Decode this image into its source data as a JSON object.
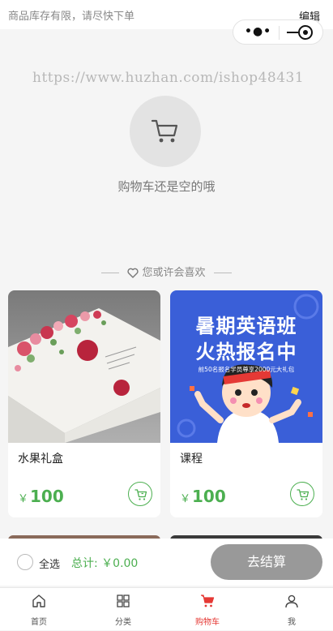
{
  "header": {
    "notice": "商品库存有限，请尽快下单",
    "edit_label": "编辑"
  },
  "watermark": "https://www.huzhan.com/ishop48431",
  "empty": {
    "icon": "cart-icon",
    "message": "购物车还是空的哦"
  },
  "recommend": {
    "title": "您或许会喜欢",
    "icon": "heart-icon",
    "items": [
      {
        "name": "水果礼盒",
        "currency": "￥",
        "price": "100",
        "image": "gift-box-photo"
      },
      {
        "name": "课程",
        "currency": "￥",
        "price": "100",
        "image": "course-poster",
        "poster_line1": "暑期英语班",
        "poster_line2": "火热报名中",
        "poster_sub": "前50名报名学员尊享2000元大礼包"
      }
    ]
  },
  "checkout": {
    "select_all": "全选",
    "total": "总计: ￥0.00",
    "button": "去结算"
  },
  "tabbar": [
    {
      "label": "首页",
      "icon": "home-icon"
    },
    {
      "label": "分类",
      "icon": "category-icon"
    },
    {
      "label": "购物车",
      "icon": "cart-icon",
      "active": true
    },
    {
      "label": "我",
      "icon": "user-icon"
    }
  ],
  "colors": {
    "accent": "#4caf50",
    "active_tab": "#e53935",
    "checkout_button": "#999999"
  }
}
